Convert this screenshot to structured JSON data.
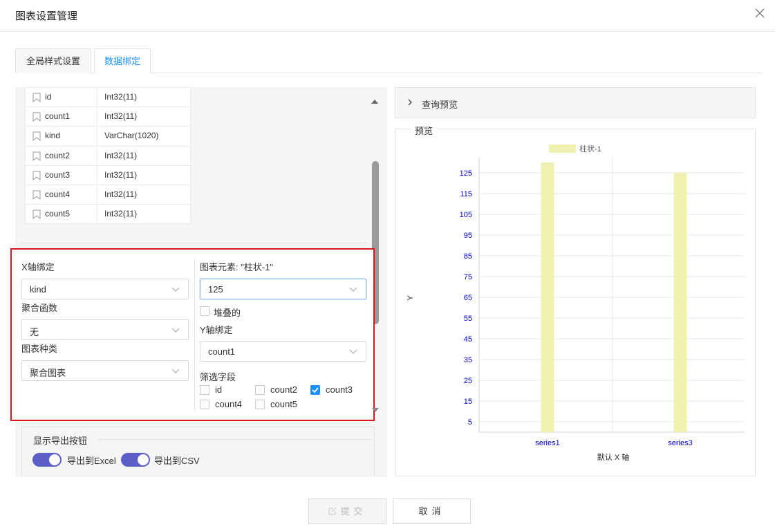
{
  "dialog": {
    "title": "图表设置管理"
  },
  "tabs": [
    {
      "label": "全局样式设置",
      "active": false
    },
    {
      "label": "数据绑定",
      "active": true
    }
  ],
  "fields": [
    {
      "name": "id",
      "type": "Int32(11)"
    },
    {
      "name": "count1",
      "type": "Int32(11)"
    },
    {
      "name": "kind",
      "type": "VarChar(1020)"
    },
    {
      "name": "count2",
      "type": "Int32(11)"
    },
    {
      "name": "count3",
      "type": "Int32(11)"
    },
    {
      "name": "count4",
      "type": "Int32(11)"
    },
    {
      "name": "count5",
      "type": "Int32(11)"
    }
  ],
  "binding": {
    "x_axis_label": "X轴绑定",
    "x_axis_value": "kind",
    "agg_label": "聚合函数",
    "agg_value": "无",
    "chart_type_label": "图表种类",
    "chart_type_value": "聚合图表",
    "element_label": "图表元素: \"柱状-1\"",
    "element_value": "125",
    "stacked_label": "堆叠的",
    "stacked_checked": false,
    "y_axis_label": "Y轴绑定",
    "y_axis_value": "count1",
    "filter_label": "筛选字段",
    "filters": [
      {
        "label": "id",
        "checked": false
      },
      {
        "label": "count2",
        "checked": false
      },
      {
        "label": "count3",
        "checked": true
      },
      {
        "label": "count4",
        "checked": false
      },
      {
        "label": "count5",
        "checked": false
      }
    ]
  },
  "export": {
    "legend": "显示导出按钮",
    "excel_label": "导出到Excel",
    "excel_on": true,
    "csv_label": "导出到CSV",
    "csv_on": true
  },
  "query_preview_label": "查询预览",
  "preview_label": "预览",
  "chart_data": {
    "type": "bar",
    "categories": [
      "series1",
      "series3"
    ],
    "series": [
      {
        "name": "柱状-1",
        "values": [
          130,
          125
        ],
        "color": "#f0f0b0"
      }
    ],
    "xlabel": "默认 X 轴",
    "ylabel": "Y",
    "yticks": [
      5,
      15,
      25,
      35,
      45,
      55,
      65,
      75,
      85,
      95,
      105,
      115,
      125
    ],
    "ylim": [
      0,
      130
    ],
    "grid": true,
    "legend_position": "top",
    "tick_color": "#0000cc"
  },
  "footer": {
    "submit_label": "提交",
    "cancel_label": "取消"
  }
}
